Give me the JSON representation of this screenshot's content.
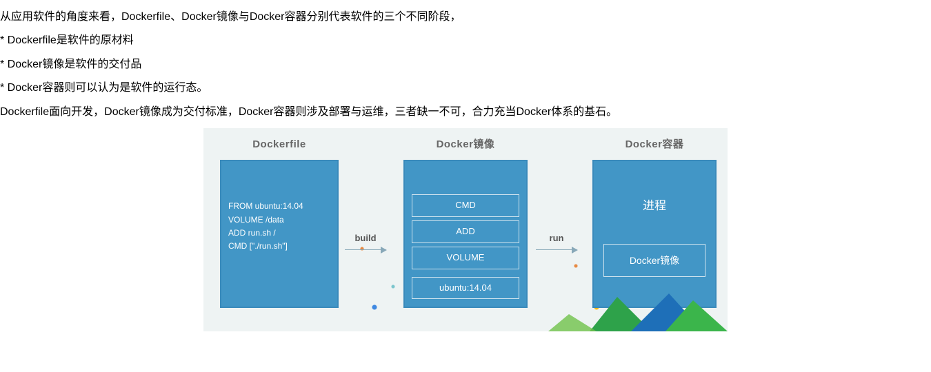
{
  "text": {
    "p1": "从应用软件的角度来看，Dockerfile、Docker镜像与Docker容器分别代表软件的三个不同阶段，",
    "b1": "*  Dockerfile是软件的原材料",
    "b2": "*  Docker镜像是软件的交付品",
    "b3": "*  Docker容器则可以认为是软件的运行态。",
    "p2": "Dockerfile面向开发，Docker镜像成为交付标准，Docker容器则涉及部署与运维，三者缺一不可，合力充当Docker体系的基石。"
  },
  "diagram": {
    "col1": {
      "title": "Dockerfile",
      "lines": [
        "FROM ubuntu:14.04",
        "VOLUME /data",
        "ADD run.sh /",
        "CMD [\"./run.sh\"]"
      ]
    },
    "arrow1": "build",
    "col2": {
      "title": "Docker镜像",
      "layers": [
        "CMD",
        "ADD",
        "VOLUME",
        "ubuntu:14.04"
      ]
    },
    "arrow2": "run",
    "col3": {
      "title": "Docker容器",
      "process": "进程",
      "inner": "Docker镜像"
    }
  }
}
